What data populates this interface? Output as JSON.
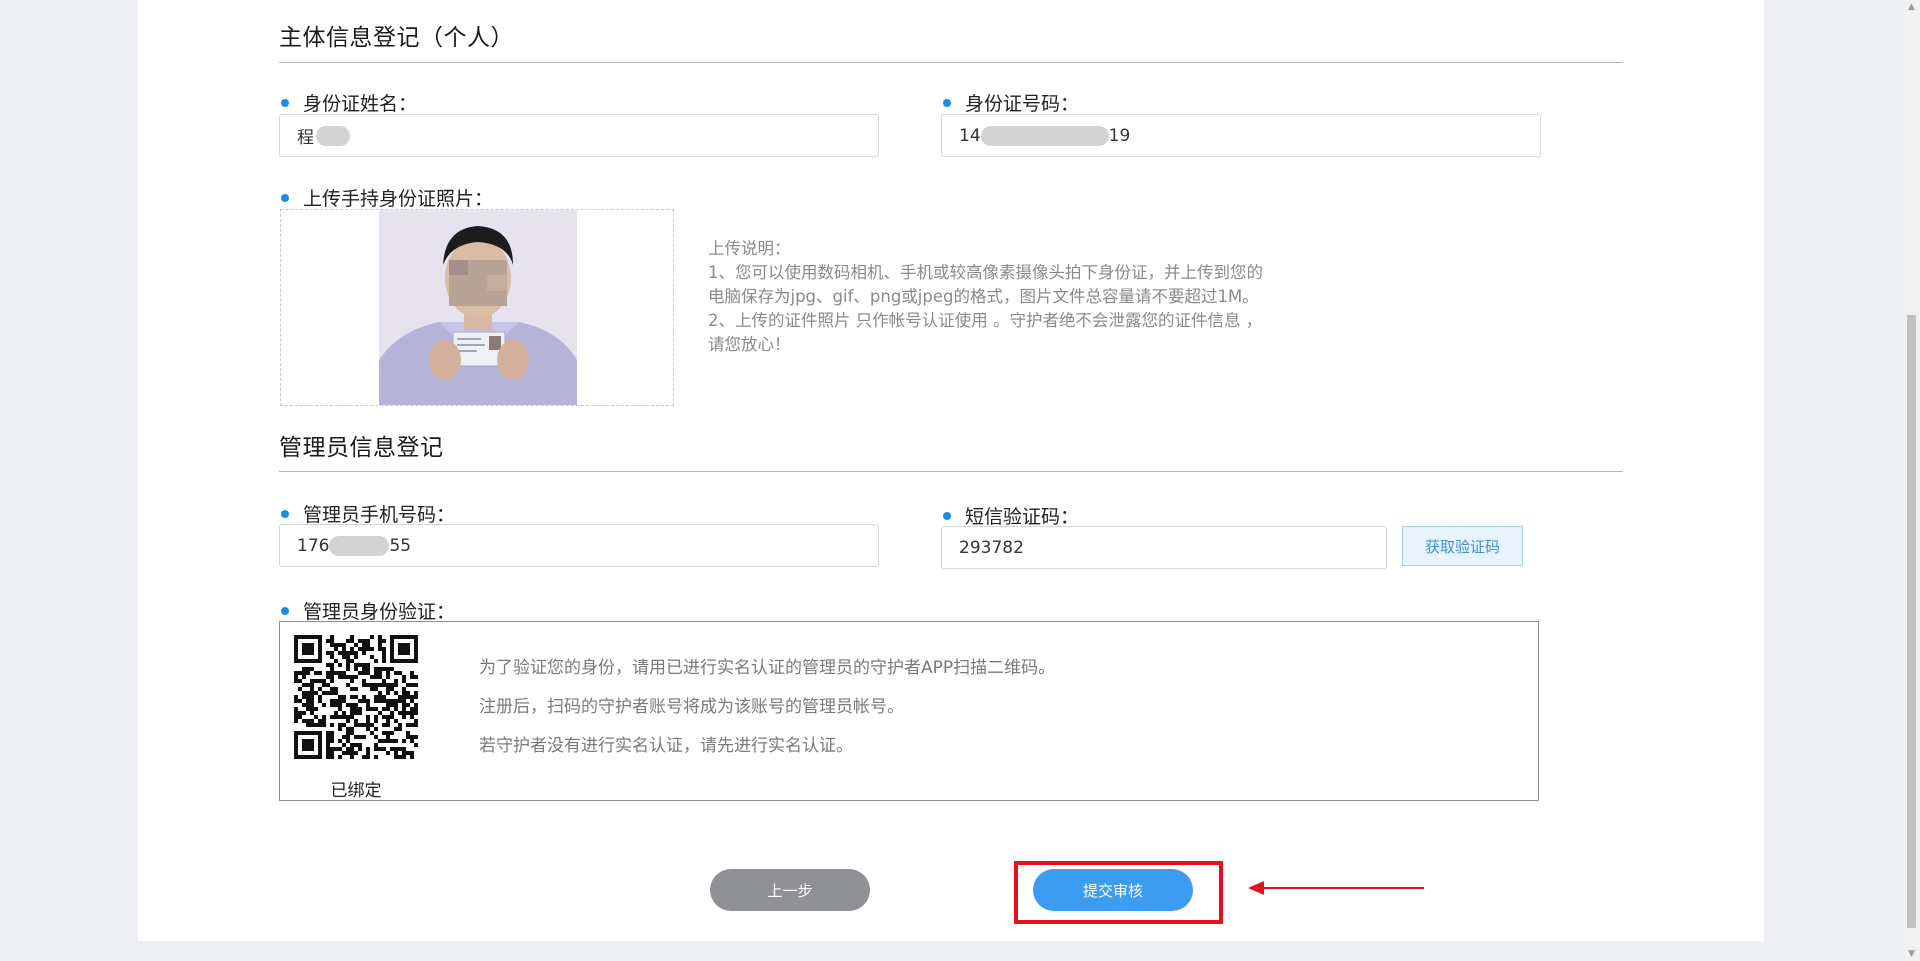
{
  "sections": {
    "subject_title": "主体信息登记（个人）",
    "admin_title": "管理员信息登记"
  },
  "subject": {
    "name_label": "身份证姓名：",
    "name_value": "程",
    "id_label": "身份证号码：",
    "id_value_prefix": "14",
    "id_value_suffix": "19",
    "photo_label": "上传手持身份证照片："
  },
  "upload_notes": [
    "上传说明：",
    "1、您可以使用数码相机、手机或较高像素摄像头拍下身份证，并上传到您的",
    "电脑保存为jpg、gif、png或jpeg的格式，图片文件总容量请不要超过1M。",
    "2、上传的证件照片 只作帐号认证使用 。守护者绝不会泄露您的证件信息 ，",
    "请您放心！"
  ],
  "admin": {
    "phone_label": "管理员手机号码：",
    "phone_prefix": "176",
    "phone_suffix": "55",
    "sms_label": "短信验证码：",
    "sms_value": "293782",
    "sms_button": "获取验证码",
    "verify_label": "管理员身份验证：",
    "qr_status": "已绑定",
    "verify_lines": [
      "为了验证您的身份，请用已进行实名认证的管理员的守护者APP扫描二维码。",
      "注册后，扫码的守护者账号将成为该账号的管理员帐号。",
      "若守护者没有进行实名认证，请先进行实名认证。"
    ]
  },
  "actions": {
    "prev": "上一步",
    "submit": "提交审核"
  },
  "colors": {
    "accent": "#3b9cf0",
    "bullet": "#1a8de6",
    "highlight": "#e5101c",
    "secondary_button": "#8f9195"
  },
  "icons": [
    "qr-code-icon",
    "red-arrow-icon",
    "scroll-up-icon",
    "scroll-down-icon"
  ]
}
